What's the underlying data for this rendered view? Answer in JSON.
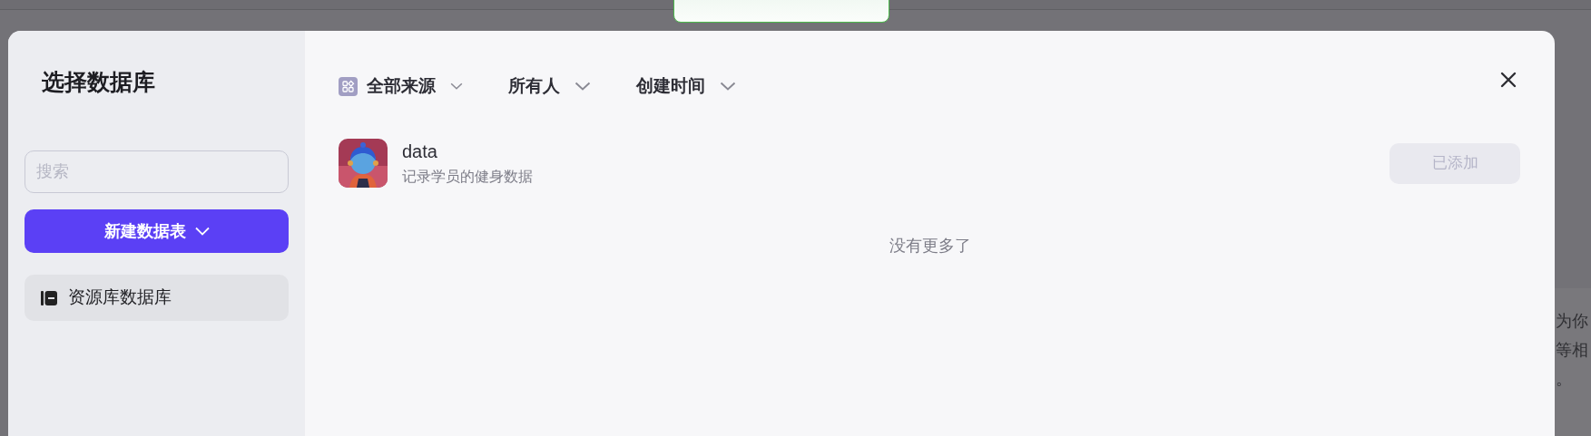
{
  "background_text": [
    "为你",
    "等相",
    "。"
  ],
  "sidebar": {
    "title": "选择数据库",
    "search": {
      "placeholder": "搜索"
    },
    "new_button": "新建数据表",
    "items": [
      {
        "label": "资源库数据库",
        "selected": true
      }
    ]
  },
  "filters": [
    {
      "kind": "with_icon",
      "label": "全部来源"
    },
    {
      "kind": "plain",
      "label": "所有人"
    },
    {
      "kind": "plain",
      "label": "创建时间"
    }
  ],
  "rows": [
    {
      "name": "data",
      "description": "记录学员的健身数据",
      "button": "已添加",
      "disabled": true
    }
  ],
  "footer": "没有更多了"
}
